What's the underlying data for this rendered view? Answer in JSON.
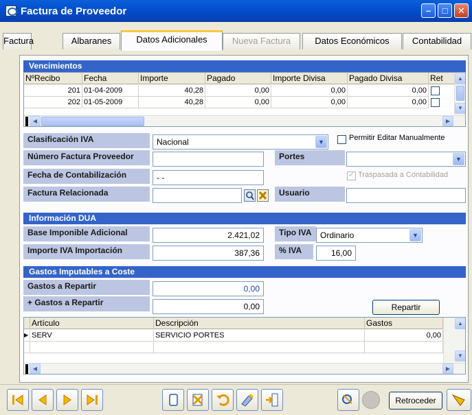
{
  "window": {
    "title": "Factura de Proveedor"
  },
  "tabs": [
    {
      "label": "Factura",
      "active": false,
      "enabled": true
    },
    {
      "label": "Albaranes",
      "active": false,
      "enabled": true
    },
    {
      "label": "Datos Adicionales",
      "active": true,
      "enabled": true
    },
    {
      "label": "Nueva Factura",
      "active": false,
      "enabled": false
    },
    {
      "label": "Datos Económicos",
      "active": false,
      "enabled": true
    },
    {
      "label": "Contabilidad",
      "active": false,
      "enabled": true
    }
  ],
  "vencimientos": {
    "title": "Vencimientos",
    "columns": [
      "NºRecibo",
      "Fecha",
      "Importe",
      "Pagado",
      "Importe Divisa",
      "Pagado Divisa",
      "Ret"
    ],
    "rows": [
      {
        "recibo": "201",
        "fecha": "01-04-2009",
        "importe": "40,28",
        "pagado": "0,00",
        "importe_divisa": "0,00",
        "pagado_divisa": "0,00",
        "ret": false
      },
      {
        "recibo": "202",
        "fecha": "01-05-2009",
        "importe": "40,28",
        "pagado": "0,00",
        "importe_divisa": "0,00",
        "pagado_divisa": "0,00",
        "ret": false
      }
    ]
  },
  "form": {
    "clasificacion_iva_label": "Clasificación IVA",
    "clasificacion_iva_value": "Nacional",
    "permitir_editar_label": "Permitir Editar Manualmente",
    "permitir_editar_checked": false,
    "numero_factura_label": "Número Factura Proveedor",
    "numero_factura_value": "",
    "portes_label": "Portes",
    "portes_value": "",
    "fecha_contab_label": "Fecha de Contabilización",
    "fecha_contab_value": "- -",
    "traspasada_label": "Traspasada a Contabilidad",
    "traspasada_checked": true,
    "factura_rel_label": "Factura Relacionada",
    "factura_rel_value": "",
    "usuario_label": "Usuario",
    "usuario_value": ""
  },
  "dua": {
    "title": "Información DUA",
    "base_label": "Base Imponible Adicional",
    "base_value": "2.421,02",
    "tipo_iva_label": "Tipo IVA",
    "tipo_iva_value": "Ordinario",
    "importe_iva_label": "Importe IVA Importación",
    "importe_iva_value": "387,36",
    "pct_iva_label": "% IVA",
    "pct_iva_value": "16,00"
  },
  "gastos": {
    "title": "Gastos Imputables a Coste",
    "repartir_label": "Gastos a Repartir",
    "repartir_value": "0,00",
    "plus_repartir_label": "+ Gastos a Repartir",
    "plus_repartir_value": "0,00",
    "repartir_button": "Repartir",
    "columns": [
      "Artículo",
      "Descripción",
      "Gastos"
    ],
    "rows": [
      {
        "articulo": "SERV",
        "descripcion": "SERVICIO PORTES",
        "gastos": "0,00"
      }
    ]
  },
  "toolbar": {
    "buttons": [
      "first-icon",
      "prev-icon",
      "next-icon",
      "last-icon",
      "new-icon",
      "delete-icon",
      "undo-icon",
      "edit-icon",
      "exit-icon",
      "search-icon",
      "status-icon"
    ],
    "retroceder_label": "Retroceder"
  },
  "colors": {
    "section": "#3464c9",
    "label_bg": "#bcc6e2",
    "title": "#0450d0"
  }
}
